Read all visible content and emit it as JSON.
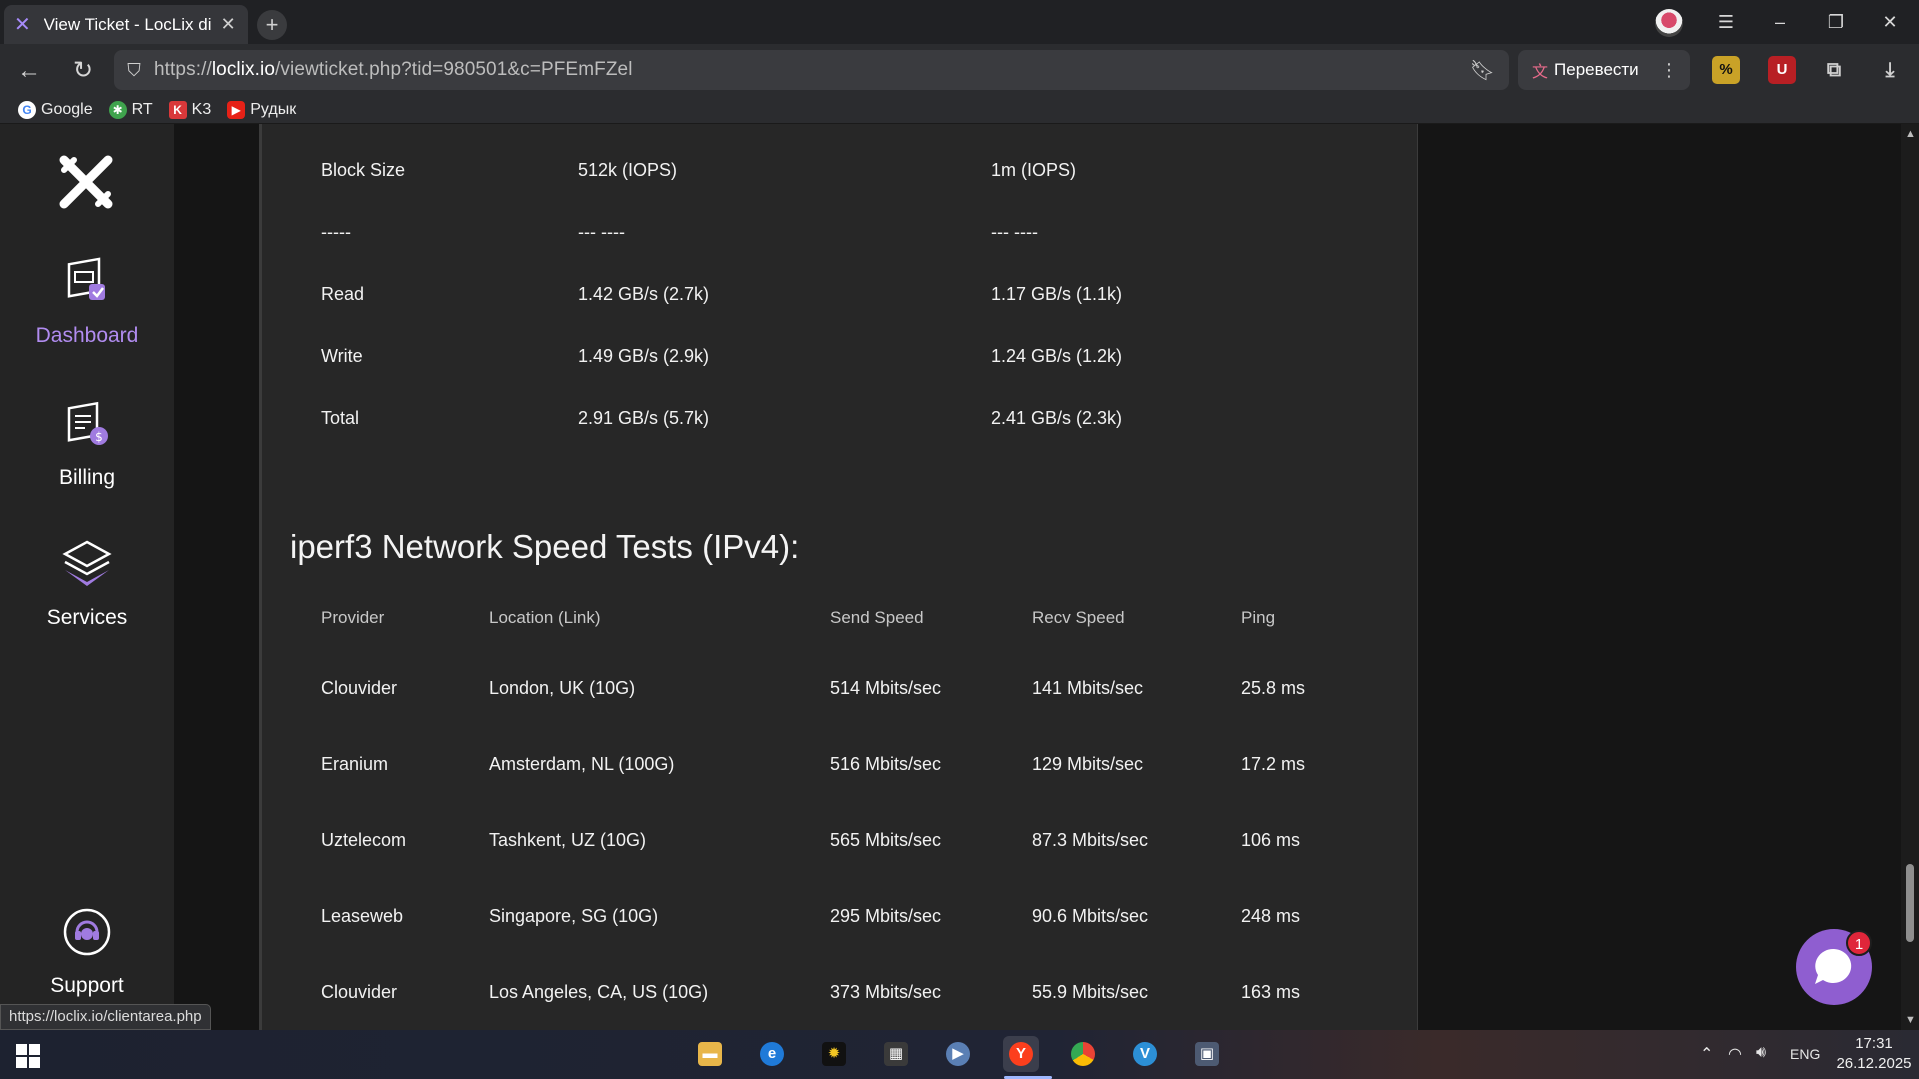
{
  "browser": {
    "tab_title": "View Ticket - LocLix di S",
    "url_prefix": "https://",
    "url_host": "loclix.io",
    "url_path": "/viewticket.php?tid=980501&c=PFEmFZel",
    "translate_label": "Перевести",
    "bookmarks": [
      {
        "label": "Google",
        "icon": "google-icon",
        "color": "#4285f4"
      },
      {
        "label": "RT",
        "icon": "rt-icon",
        "color": "#3fa34d"
      },
      {
        "label": "K3",
        "icon": "k3-icon",
        "color": "#d9383a"
      },
      {
        "label": "Рудык",
        "icon": "youtube-icon",
        "color": "#e62117"
      }
    ]
  },
  "sidebar": {
    "items": [
      {
        "label": "Dashboard",
        "icon": "dashboard-icon",
        "active": true
      },
      {
        "label": "Billing",
        "icon": "billing-icon",
        "active": false
      },
      {
        "label": "Services",
        "icon": "services-icon",
        "active": false
      },
      {
        "label": "Support",
        "icon": "support-icon",
        "active": false
      }
    ],
    "accent_color": "#b18cf0"
  },
  "disk_table": {
    "rows": [
      {
        "c1": "Block Size",
        "c2": "512k (IOPS)",
        "c3": "1m (IOPS)"
      },
      {
        "c1": "-----",
        "c2": "--- ----",
        "c3": "--- ----"
      },
      {
        "c1": "Read",
        "c2": "1.42 GB/s (2.7k)",
        "c3": "1.17 GB/s (1.1k)"
      },
      {
        "c1": "Write",
        "c2": "1.49 GB/s (2.9k)",
        "c3": "1.24 GB/s (1.2k)"
      },
      {
        "c1": "Total",
        "c2": "2.91 GB/s (5.7k)",
        "c3": "2.41 GB/s (2.3k)"
      }
    ]
  },
  "network": {
    "title": "iperf3 Network Speed Tests (IPv4):",
    "headers": [
      "Provider",
      "Location (Link)",
      "Send Speed",
      "Recv Speed",
      "Ping"
    ],
    "rows": [
      [
        "Clouvider",
        "London, UK (10G)",
        "514 Mbits/sec",
        "141 Mbits/sec",
        "25.8 ms"
      ],
      [
        "Eranium",
        "Amsterdam, NL (100G)",
        "516 Mbits/sec",
        "129 Mbits/sec",
        "17.2 ms"
      ],
      [
        "Uztelecom",
        "Tashkent, UZ (10G)",
        "565 Mbits/sec",
        "87.3 Mbits/sec",
        "106 ms"
      ],
      [
        "Leaseweb",
        "Singapore, SG (10G)",
        "295 Mbits/sec",
        "90.6 Mbits/sec",
        "248 ms"
      ],
      [
        "Clouvider",
        "Los Angeles, CA, US (10G)",
        "373 Mbits/sec",
        "55.9 Mbits/sec",
        "163 ms"
      ]
    ]
  },
  "chat": {
    "badge": "1"
  },
  "status_url": "https://loclix.io/clientarea.php",
  "taskbar": {
    "apps": [
      "file-explorer-icon",
      "edge-icon",
      "paint-icon",
      "calculator-icon",
      "media-player-icon",
      "yandex-browser-icon",
      "chrome-icon",
      "app-v-icon",
      "remote-desktop-icon"
    ],
    "language": "ENG",
    "time": "17:31",
    "date": "26.12.2025"
  }
}
